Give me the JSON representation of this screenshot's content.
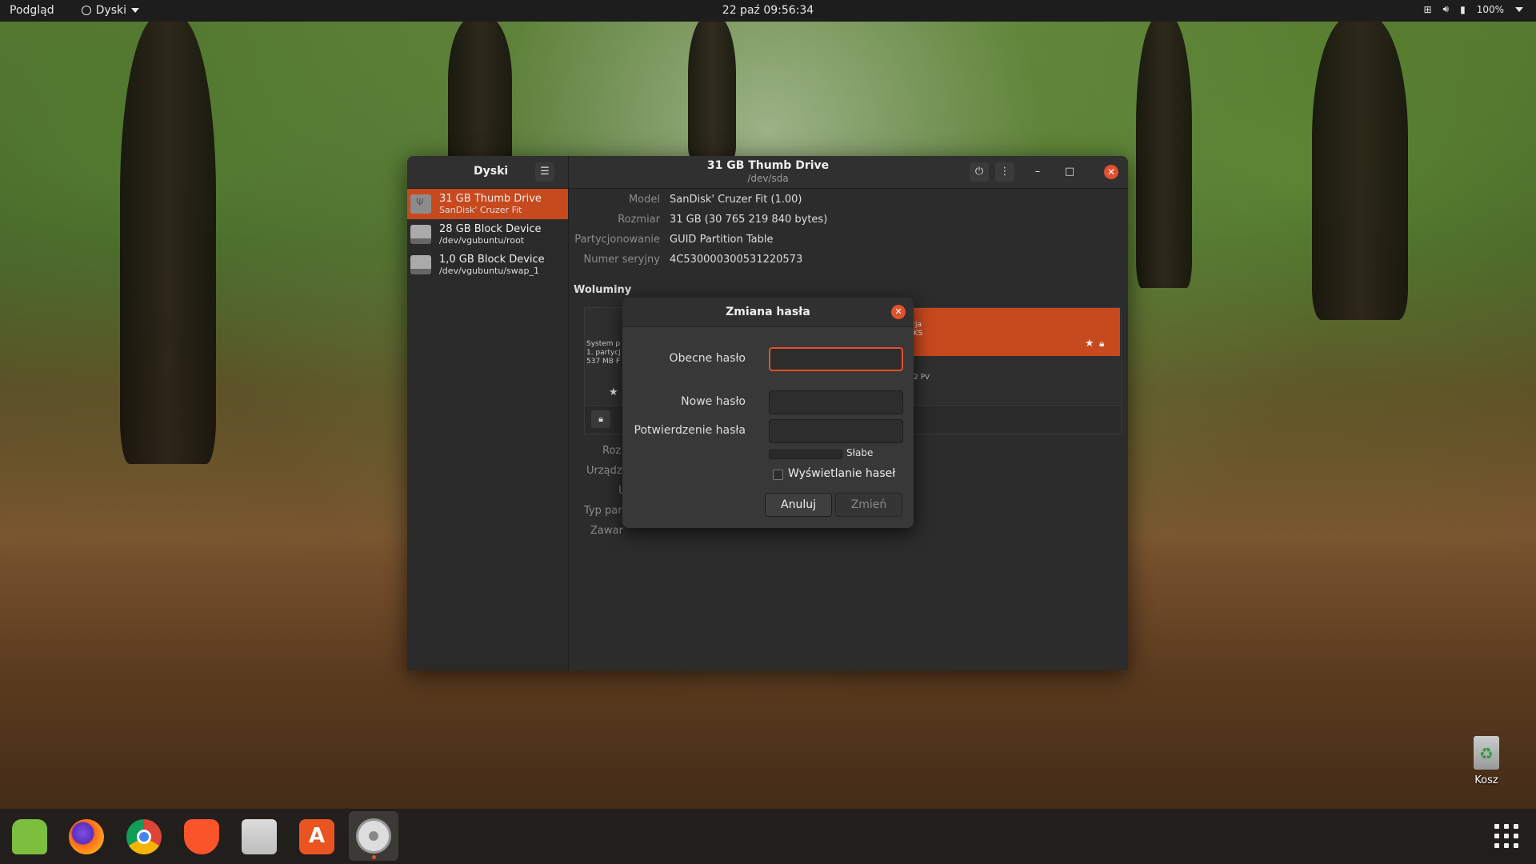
{
  "topbar": {
    "activities": "Podgląd",
    "app_menu": "Dyski",
    "clock": "22 paź  09:56:34",
    "battery": "100%"
  },
  "window": {
    "sidebar_title": "Dyski",
    "title": "31 GB Thumb Drive",
    "subtitle": "/dev/sda",
    "drives": [
      {
        "name": "31 GB Thumb Drive",
        "sub": "SanDisk' Cruzer Fit"
      },
      {
        "name": "28 GB Block Device",
        "sub": "/dev/vgubuntu/root"
      },
      {
        "name": "1,0 GB Block Device",
        "sub": "/dev/vgubuntu/swap_1"
      }
    ],
    "properties": {
      "model_label": "Model",
      "model": "SanDisk' Cruzer Fit (1.00)",
      "size_label": "Rozmiar",
      "size": "31 GB (30 765 219 840 bytes)",
      "partitioning_label": "Partycjonowanie",
      "partitioning": "GUID Partition Table",
      "serial_label": "Numer seryjny",
      "serial": "4C530000300531220573"
    },
    "volumes_title": "Woluminy",
    "volumes": {
      "seg1_line1": "System p",
      "seg1_line2": "1. partycj",
      "seg1_line3": "537 MB F",
      "seg2_line1": "cja",
      "seg2_line2": "JKS",
      "seg3_line1": "/2 PV"
    },
    "volume_props": {
      "k1": "Roz",
      "k2": "Urządz",
      "k3": "U",
      "k4": "Typ par",
      "k5": "Zawar"
    }
  },
  "dialog": {
    "title": "Zmiana hasła",
    "current_label": "Obecne hasło",
    "current_value": "",
    "new_label": "Nowe hasło",
    "new_value": "",
    "confirm_label": "Potwierdzenie hasła",
    "confirm_value": "",
    "strength": "Słabe",
    "show_passwords": "Wyświetlanie haseł",
    "cancel": "Anuluj",
    "ok": "Zmień"
  },
  "desktop": {
    "trash_label": "Kosz"
  },
  "dock": {
    "apps": [
      "android-studio-icon",
      "firefox-icon",
      "chrome-icon",
      "brave-icon",
      "files-icon",
      "software-center-icon",
      "disks-icon"
    ]
  },
  "colors": {
    "accent": "#e2502c",
    "selected": "#c7491e",
    "window_bg": "#2c2c2c"
  }
}
